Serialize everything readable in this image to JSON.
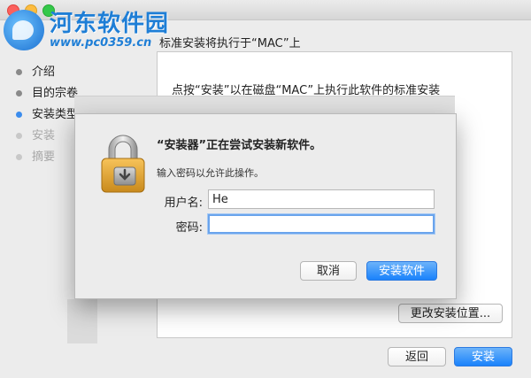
{
  "watermark": {
    "site_name": "河东软件园",
    "url": "www.pc0359.cn"
  },
  "installer": {
    "header": "标准安装将执行于“MAC”上",
    "steps": [
      {
        "label": "介绍",
        "state": "done"
      },
      {
        "label": "目的宗卷",
        "state": "done"
      },
      {
        "label": "安装类型",
        "state": "active"
      },
      {
        "label": "安装",
        "state": "disabled"
      },
      {
        "label": "摘要",
        "state": "disabled"
      }
    ],
    "content_text": "点按“安装”以在磁盘“MAC”上执行此软件的标准安装",
    "change_location_label": "更改安装位置...",
    "back_label": "返回",
    "install_label": "安装"
  },
  "auth_dialog": {
    "icon": "lock-icon",
    "title": "“安装器”正在尝试安装新软件。",
    "message": "输入密码以允许此操作。",
    "username_label": "用户名:",
    "username_value": "He",
    "password_label": "密码:",
    "password_value": "",
    "cancel_label": "取消",
    "confirm_label": "安装软件"
  },
  "colors": {
    "accent": "#1a82fb",
    "active_step": "#3b8ced",
    "watermark": "#1e7ed6"
  }
}
